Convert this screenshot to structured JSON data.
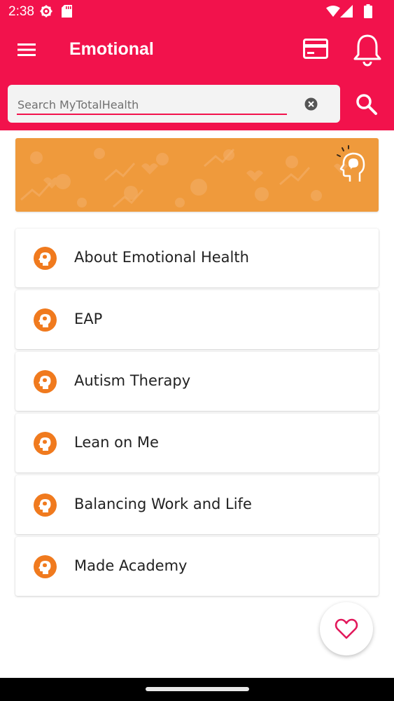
{
  "status_bar": {
    "time": "2:38",
    "icons": [
      "settings-icon",
      "sd-card-icon",
      "wifi-icon",
      "signal-icon",
      "battery-icon"
    ]
  },
  "app_bar": {
    "title": "Emotional",
    "icons": [
      "menu-icon",
      "card-icon",
      "bell-icon"
    ]
  },
  "search": {
    "placeholder": "Search MyTotalHealth",
    "value": "",
    "icons": [
      "clear-icon",
      "search-icon"
    ]
  },
  "banner": {
    "icon": "head-brain-icon"
  },
  "list": {
    "items": [
      {
        "label": "About Emotional Health",
        "icon": "brain-head-icon"
      },
      {
        "label": "EAP",
        "icon": "brain-head-icon"
      },
      {
        "label": "Autism Therapy",
        "icon": "brain-head-icon"
      },
      {
        "label": "Lean on Me",
        "icon": "brain-head-icon"
      },
      {
        "label": "Balancing Work and Life",
        "icon": "brain-head-icon"
      },
      {
        "label": "Made Academy",
        "icon": "brain-head-icon"
      }
    ]
  },
  "fab": {
    "icon": "heart-icon"
  },
  "colors": {
    "primary": "#f2124c",
    "accent_orange": "#f07a1e",
    "banner_orange": "#ef9a3c",
    "heart": "#e2185b"
  }
}
